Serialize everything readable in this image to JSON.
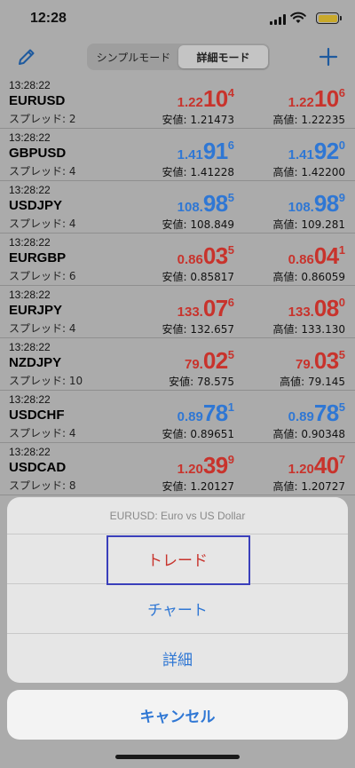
{
  "status": {
    "time": "12:28"
  },
  "nav": {
    "segments": [
      "シンプルモード",
      "詳細モード"
    ],
    "active_segment": 1
  },
  "colors": {
    "down": "#c8332c",
    "up": "#2f77d4"
  },
  "rows": [
    {
      "time": "13:28:22",
      "symbol": "EURUSD",
      "spread": "スプレッド: 2",
      "dir": "down",
      "bid": {
        "small": "1.22",
        "big": "10",
        "sup": "4"
      },
      "ask": {
        "small": "1.22",
        "big": "10",
        "sup": "6"
      },
      "low": "安値: 1.21473",
      "high": "高値: 1.22235"
    },
    {
      "time": "13:28:22",
      "symbol": "GBPUSD",
      "spread": "スプレッド: 4",
      "dir": "up",
      "bid": {
        "small": "1.41",
        "big": "91",
        "sup": "6"
      },
      "ask": {
        "small": "1.41",
        "big": "92",
        "sup": "0"
      },
      "low": "安値: 1.41228",
      "high": "高値: 1.42200"
    },
    {
      "time": "13:28:22",
      "symbol": "USDJPY",
      "spread": "スプレッド: 4",
      "dir": "up",
      "bid": {
        "small": "108.",
        "big": "98",
        "sup": "5"
      },
      "ask": {
        "small": "108.",
        "big": "98",
        "sup": "9"
      },
      "low": "安値: 108.849",
      "high": "高値: 109.281"
    },
    {
      "time": "13:28:22",
      "symbol": "EURGBP",
      "spread": "スプレッド: 6",
      "dir": "down",
      "bid": {
        "small": "0.86",
        "big": "03",
        "sup": "5"
      },
      "ask": {
        "small": "0.86",
        "big": "04",
        "sup": "1"
      },
      "low": "安値: 0.85817",
      "high": "高値: 0.86059"
    },
    {
      "time": "13:28:22",
      "symbol": "EURJPY",
      "spread": "スプレッド: 4",
      "dir": "down",
      "bid": {
        "small": "133.",
        "big": "07",
        "sup": "6"
      },
      "ask": {
        "small": "133.",
        "big": "08",
        "sup": "0"
      },
      "low": "安値: 132.657",
      "high": "高値: 133.130"
    },
    {
      "time": "13:28:22",
      "symbol": "NZDJPY",
      "spread": "スプレッド: 10",
      "dir": "down",
      "bid": {
        "small": "79.",
        "big": "02",
        "sup": "5"
      },
      "ask": {
        "small": "79.",
        "big": "03",
        "sup": "5"
      },
      "low": "安値: 78.575",
      "high": "高値: 79.145"
    },
    {
      "time": "13:28:22",
      "symbol": "USDCHF",
      "spread": "スプレッド: 4",
      "dir": "up",
      "bid": {
        "small": "0.89",
        "big": "78",
        "sup": "1"
      },
      "ask": {
        "small": "0.89",
        "big": "78",
        "sup": "5"
      },
      "low": "安値: 0.89651",
      "high": "高値: 0.90348"
    },
    {
      "time": "13:28:22",
      "symbol": "USDCAD",
      "spread": "スプレッド: 8",
      "dir": "down",
      "bid": {
        "small": "1.20",
        "big": "39",
        "sup": "9"
      },
      "ask": {
        "small": "1.20",
        "big": "40",
        "sup": "7"
      },
      "low": "安値: 1.20127",
      "high": "高値: 1.20727"
    }
  ],
  "sheet": {
    "title": "EURUSD: Euro vs US Dollar",
    "trade": "トレード",
    "chart": "チャート",
    "detail": "詳細",
    "cancel": "キャンセル"
  },
  "icons": {
    "edit": "pencil-icon",
    "add": "plus-icon",
    "wifi": "wifi-icon",
    "battery": "battery-icon",
    "signal": "signal-icon"
  }
}
